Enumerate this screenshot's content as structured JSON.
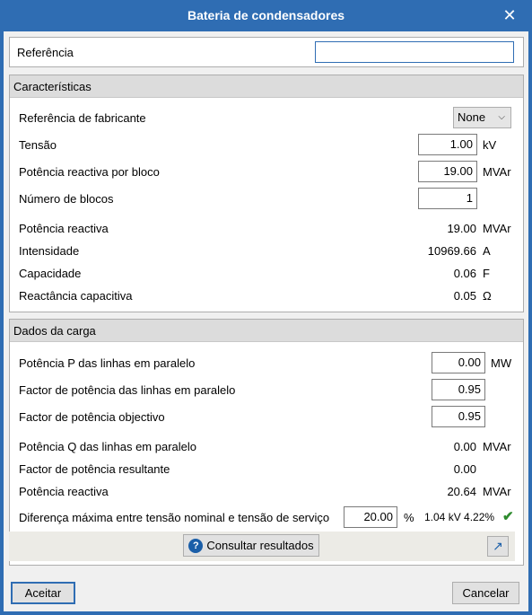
{
  "window": {
    "title": "Bateria de condensadores"
  },
  "reference": {
    "label": "Referência",
    "value": ""
  },
  "characteristics": {
    "title": "Características",
    "manufacturer_ref": {
      "label": "Referência de fabricante",
      "value": "None"
    },
    "voltage": {
      "label": "Tensão",
      "value": "1.00",
      "unit": "kV"
    },
    "reactive_power_per_block": {
      "label": "Potência reactiva por bloco",
      "value": "19.00",
      "unit": "MVAr"
    },
    "num_blocks": {
      "label": "Número de blocos",
      "value": "1"
    },
    "reactive_power": {
      "label": "Potência reactiva",
      "value": "19.00",
      "unit": "MVAr"
    },
    "current": {
      "label": "Intensidade",
      "value": "10969.66",
      "unit": "A"
    },
    "capacitance": {
      "label": "Capacidade",
      "value": "0.06",
      "unit": "F"
    },
    "capacitive_reactance": {
      "label": "Reactância capacitiva",
      "value": "0.05",
      "unit": "Ω"
    }
  },
  "load": {
    "title": "Dados da carga",
    "active_power": {
      "label": "Potência P das linhas em paralelo",
      "value": "0.00",
      "unit": "MW"
    },
    "power_factor": {
      "label": "Factor de potência das linhas em paralelo",
      "value": "0.95"
    },
    "target_power_factor": {
      "label": "Factor de potência objectivo",
      "value": "0.95"
    },
    "reactive_power_q": {
      "label": "Potência Q das linhas em paralelo",
      "value": "0.00",
      "unit": "MVAr"
    },
    "resulting_power_factor": {
      "label": "Factor de potência resultante",
      "value": "0.00"
    },
    "reactive_power": {
      "label": "Potência reactiva",
      "value": "20.64",
      "unit": "MVAr"
    },
    "max_voltage_diff": {
      "label": "Diferença máxima entre tensão nominal e tensão de serviço",
      "value": "20.00",
      "unit": "%",
      "result": "1.04 kV 4.22%"
    },
    "consult_button": "Consultar resultados"
  },
  "footer": {
    "accept": "Aceitar",
    "cancel": "Cancelar"
  },
  "colors": {
    "titlebar": "#2f6db3",
    "check": "#2e8b2e",
    "help_icon": "#1a5ea8"
  },
  "icons": {
    "close": "close-icon",
    "help": "help-icon",
    "check": "check-icon",
    "expand": "expand-arrow-icon",
    "dropdown": "chevron-down-icon"
  }
}
